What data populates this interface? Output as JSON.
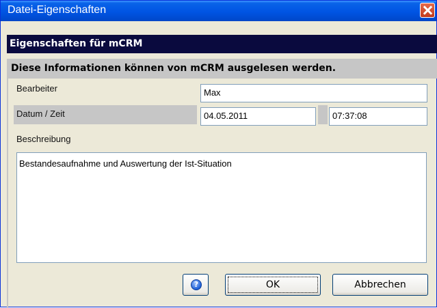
{
  "window": {
    "title": "Datei-Eigenschaften"
  },
  "header": {
    "title": "Eigenschaften für mCRM"
  },
  "info": {
    "text": "Diese Informationen können von mCRM ausgelesen werden."
  },
  "fields": {
    "bearbeiter": {
      "label": "Bearbeiter",
      "value": "Max"
    },
    "datum_zeit": {
      "label": "Datum / Zeit",
      "date": "04.05.2011",
      "time": "07:37:08"
    },
    "beschreibung": {
      "label": "Beschreibung",
      "value": "Bestandesaufnahme und Auswertung der Ist-Situation"
    }
  },
  "buttons": {
    "help_glyph": "?",
    "ok": "OK",
    "cancel": "Abbrechen"
  },
  "icons": {
    "help": "help-icon",
    "close": "close-icon"
  }
}
